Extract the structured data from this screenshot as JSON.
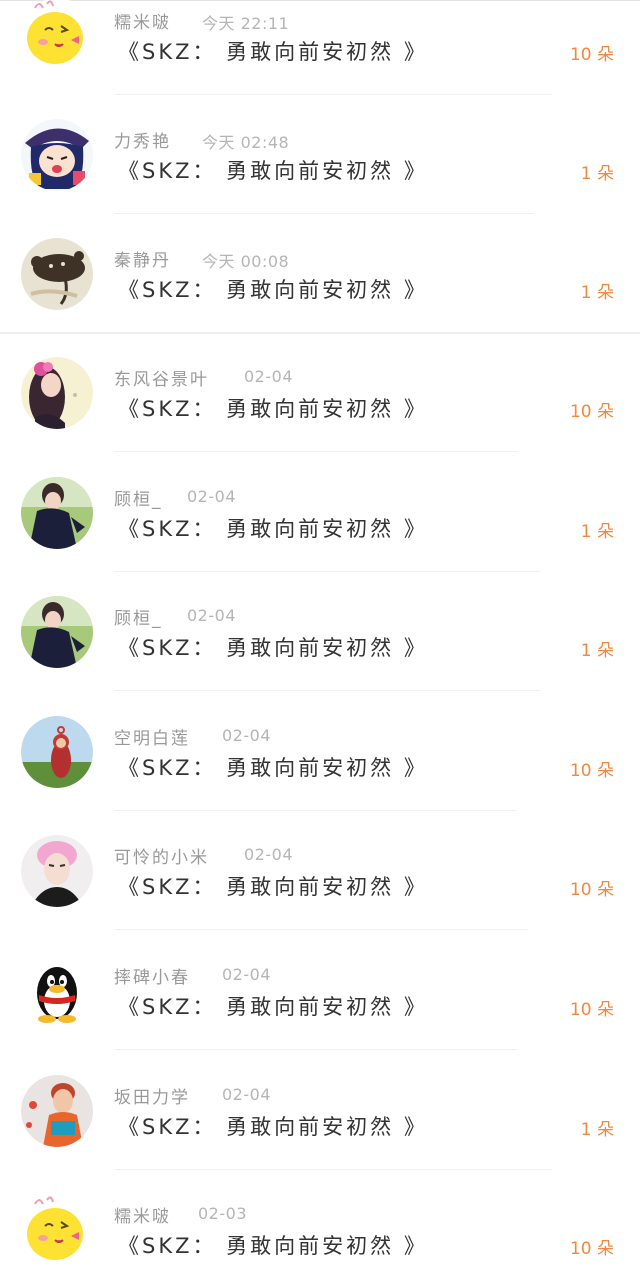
{
  "records": [
    {
      "avatar": "chick-emoji-avatar",
      "name": "糯米啵",
      "time": "今天 22:11",
      "gift": "《SKZ：  勇敢向前安初然 》",
      "quantity": "10 朵"
    },
    {
      "avatar": "cartoon-girl-avatar",
      "name": "力秀艳",
      "time": "今天 02:48",
      "gift": "《SKZ：  勇敢向前安初然 》",
      "quantity": "1 朵"
    },
    {
      "avatar": "rat-photo-avatar",
      "name": "秦静丹",
      "time": "今天 00:08",
      "gift": "《SKZ：  勇敢向前安初然 》",
      "quantity": "1 朵"
    },
    {
      "avatar": "girl-flower-avatar",
      "name": "东风谷景叶",
      "time": "02-04",
      "gift": "《SKZ：  勇敢向前安初然 》",
      "quantity": "10 朵"
    },
    {
      "avatar": "boy-photo-avatar",
      "name": "顾桓_",
      "time": "02-04",
      "gift": "《SKZ：  勇敢向前安初然 》",
      "quantity": "1 朵"
    },
    {
      "avatar": "boy-photo-avatar",
      "name": "顾桓_",
      "time": "02-04",
      "gift": "《SKZ：  勇敢向前安初然 》",
      "quantity": "1 朵"
    },
    {
      "avatar": "teletubby-avatar",
      "name": "空明白莲",
      "time": "02-04",
      "gift": "《SKZ：  勇敢向前安初然 》",
      "quantity": "10 朵"
    },
    {
      "avatar": "pink-hair-avatar",
      "name": "可怜的小米",
      "time": "02-04",
      "gift": "《SKZ：  勇敢向前安初然 》",
      "quantity": "10 朵"
    },
    {
      "avatar": "qq-penguin-avatar",
      "name": "摔碑小春",
      "time": "02-04",
      "gift": "《SKZ：  勇敢向前安初然 》",
      "quantity": "10 朵"
    },
    {
      "avatar": "kid-photo-avatar",
      "name": "坂田力学",
      "time": "02-04",
      "gift": "《SKZ：  勇敢向前安初然 》",
      "quantity": "1 朵"
    },
    {
      "avatar": "chick-emoji-avatar",
      "name": "糯米啵",
      "time": "02-03",
      "gift": "《SKZ：  勇敢向前安初然 》",
      "quantity": "10 朵"
    }
  ],
  "colors": {
    "name": "#999999",
    "time": "#b5b5b5",
    "gift_title": "#333333",
    "quantity": "#f0883f"
  }
}
